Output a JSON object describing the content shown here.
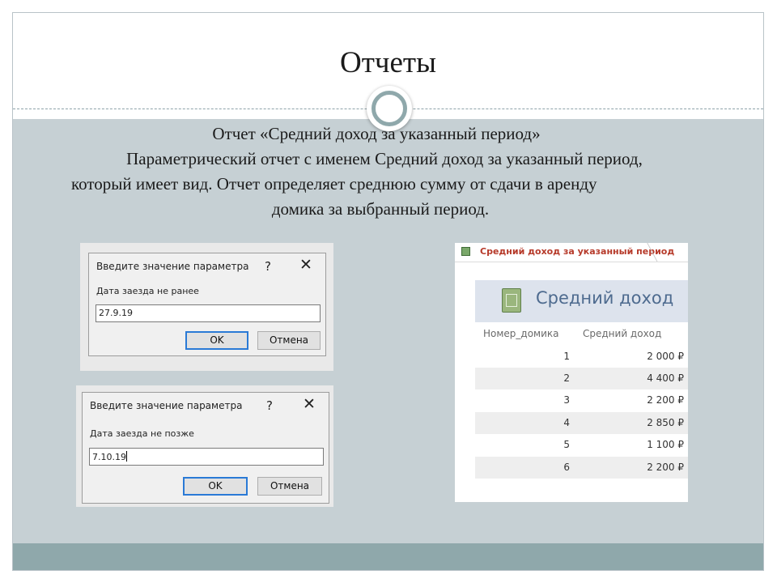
{
  "slide": {
    "title": "Отчеты",
    "heading": "Отчет «Средний доход за указанный период»",
    "paragraph_line1": "Параметрический отчет с именем Средний доход за указанный период,",
    "paragraph_line2": "который имеет вид. Отчет определяет среднюю сумму от сдачи в аренду",
    "paragraph_line3": "домика за выбранный период."
  },
  "dialog1": {
    "title": "Введите значение параметра",
    "help": "?",
    "close": "✕",
    "label": "Дата заезда не ранее",
    "value": "27.9.19",
    "ok": "OK",
    "cancel": "Отмена"
  },
  "dialog2": {
    "title": "Введите значение параметра",
    "help": "?",
    "close": "✕",
    "label": "Дата заезда не позже",
    "value": "7.10.19",
    "ok": "OK",
    "cancel": "Отмена"
  },
  "report": {
    "tab_label": "Средний доход за указанный период",
    "header_title": "Средний доход",
    "columns": [
      "Номер_домика",
      "Средний доход"
    ],
    "rows": [
      {
        "house": "1",
        "income": "2 000 ₽"
      },
      {
        "house": "2",
        "income": "4 400 ₽"
      },
      {
        "house": "3",
        "income": "2 200 ₽"
      },
      {
        "house": "4",
        "income": "2 850 ₽"
      },
      {
        "house": "5",
        "income": "1 100 ₽"
      },
      {
        "house": "6",
        "income": "2 200 ₽"
      }
    ]
  },
  "colors": {
    "content_bg": "#c6d0d4",
    "accent": "#8fa8ab",
    "report_title": "#4e6b8f",
    "report_tab": "#b63a2a",
    "ok_border": "#2a7ad6"
  }
}
